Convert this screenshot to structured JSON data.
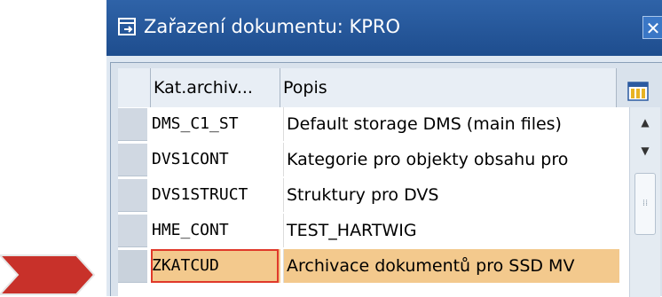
{
  "dialog": {
    "title": "Zařazení dokumentu: KPRO",
    "close_glyph": "✕"
  },
  "table": {
    "columns": [
      "Kat.archiv...",
      "Popis"
    ],
    "rows": [
      {
        "code": "DMS_C1_ST",
        "description": "Default storage DMS (main files)"
      },
      {
        "code": "DVS1CONT",
        "description": "Kategorie pro objekty obsahu pro"
      },
      {
        "code": "DVS1STRUCT",
        "description": "Struktury pro DVS"
      },
      {
        "code": "HME_CONT",
        "description": "TEST_HARTWIG"
      },
      {
        "code": "ZKATCUD",
        "description": "Archivace dokumentů pro SSD MV"
      }
    ],
    "highlighted_row": 4
  },
  "scrollbar": {
    "up_glyph": "▲",
    "down_glyph": "▼",
    "thumb_grip": "⁞⁞"
  },
  "icons": {
    "title": "document-link-icon",
    "columns_config": "column-layout-icon",
    "pointer": "red-chevron-arrow-icon"
  },
  "colors": {
    "titlebar": "#1e4d8e",
    "highlight": "#f3c98d",
    "highlight_border": "#e0392a",
    "arrow": "#c8312a"
  }
}
